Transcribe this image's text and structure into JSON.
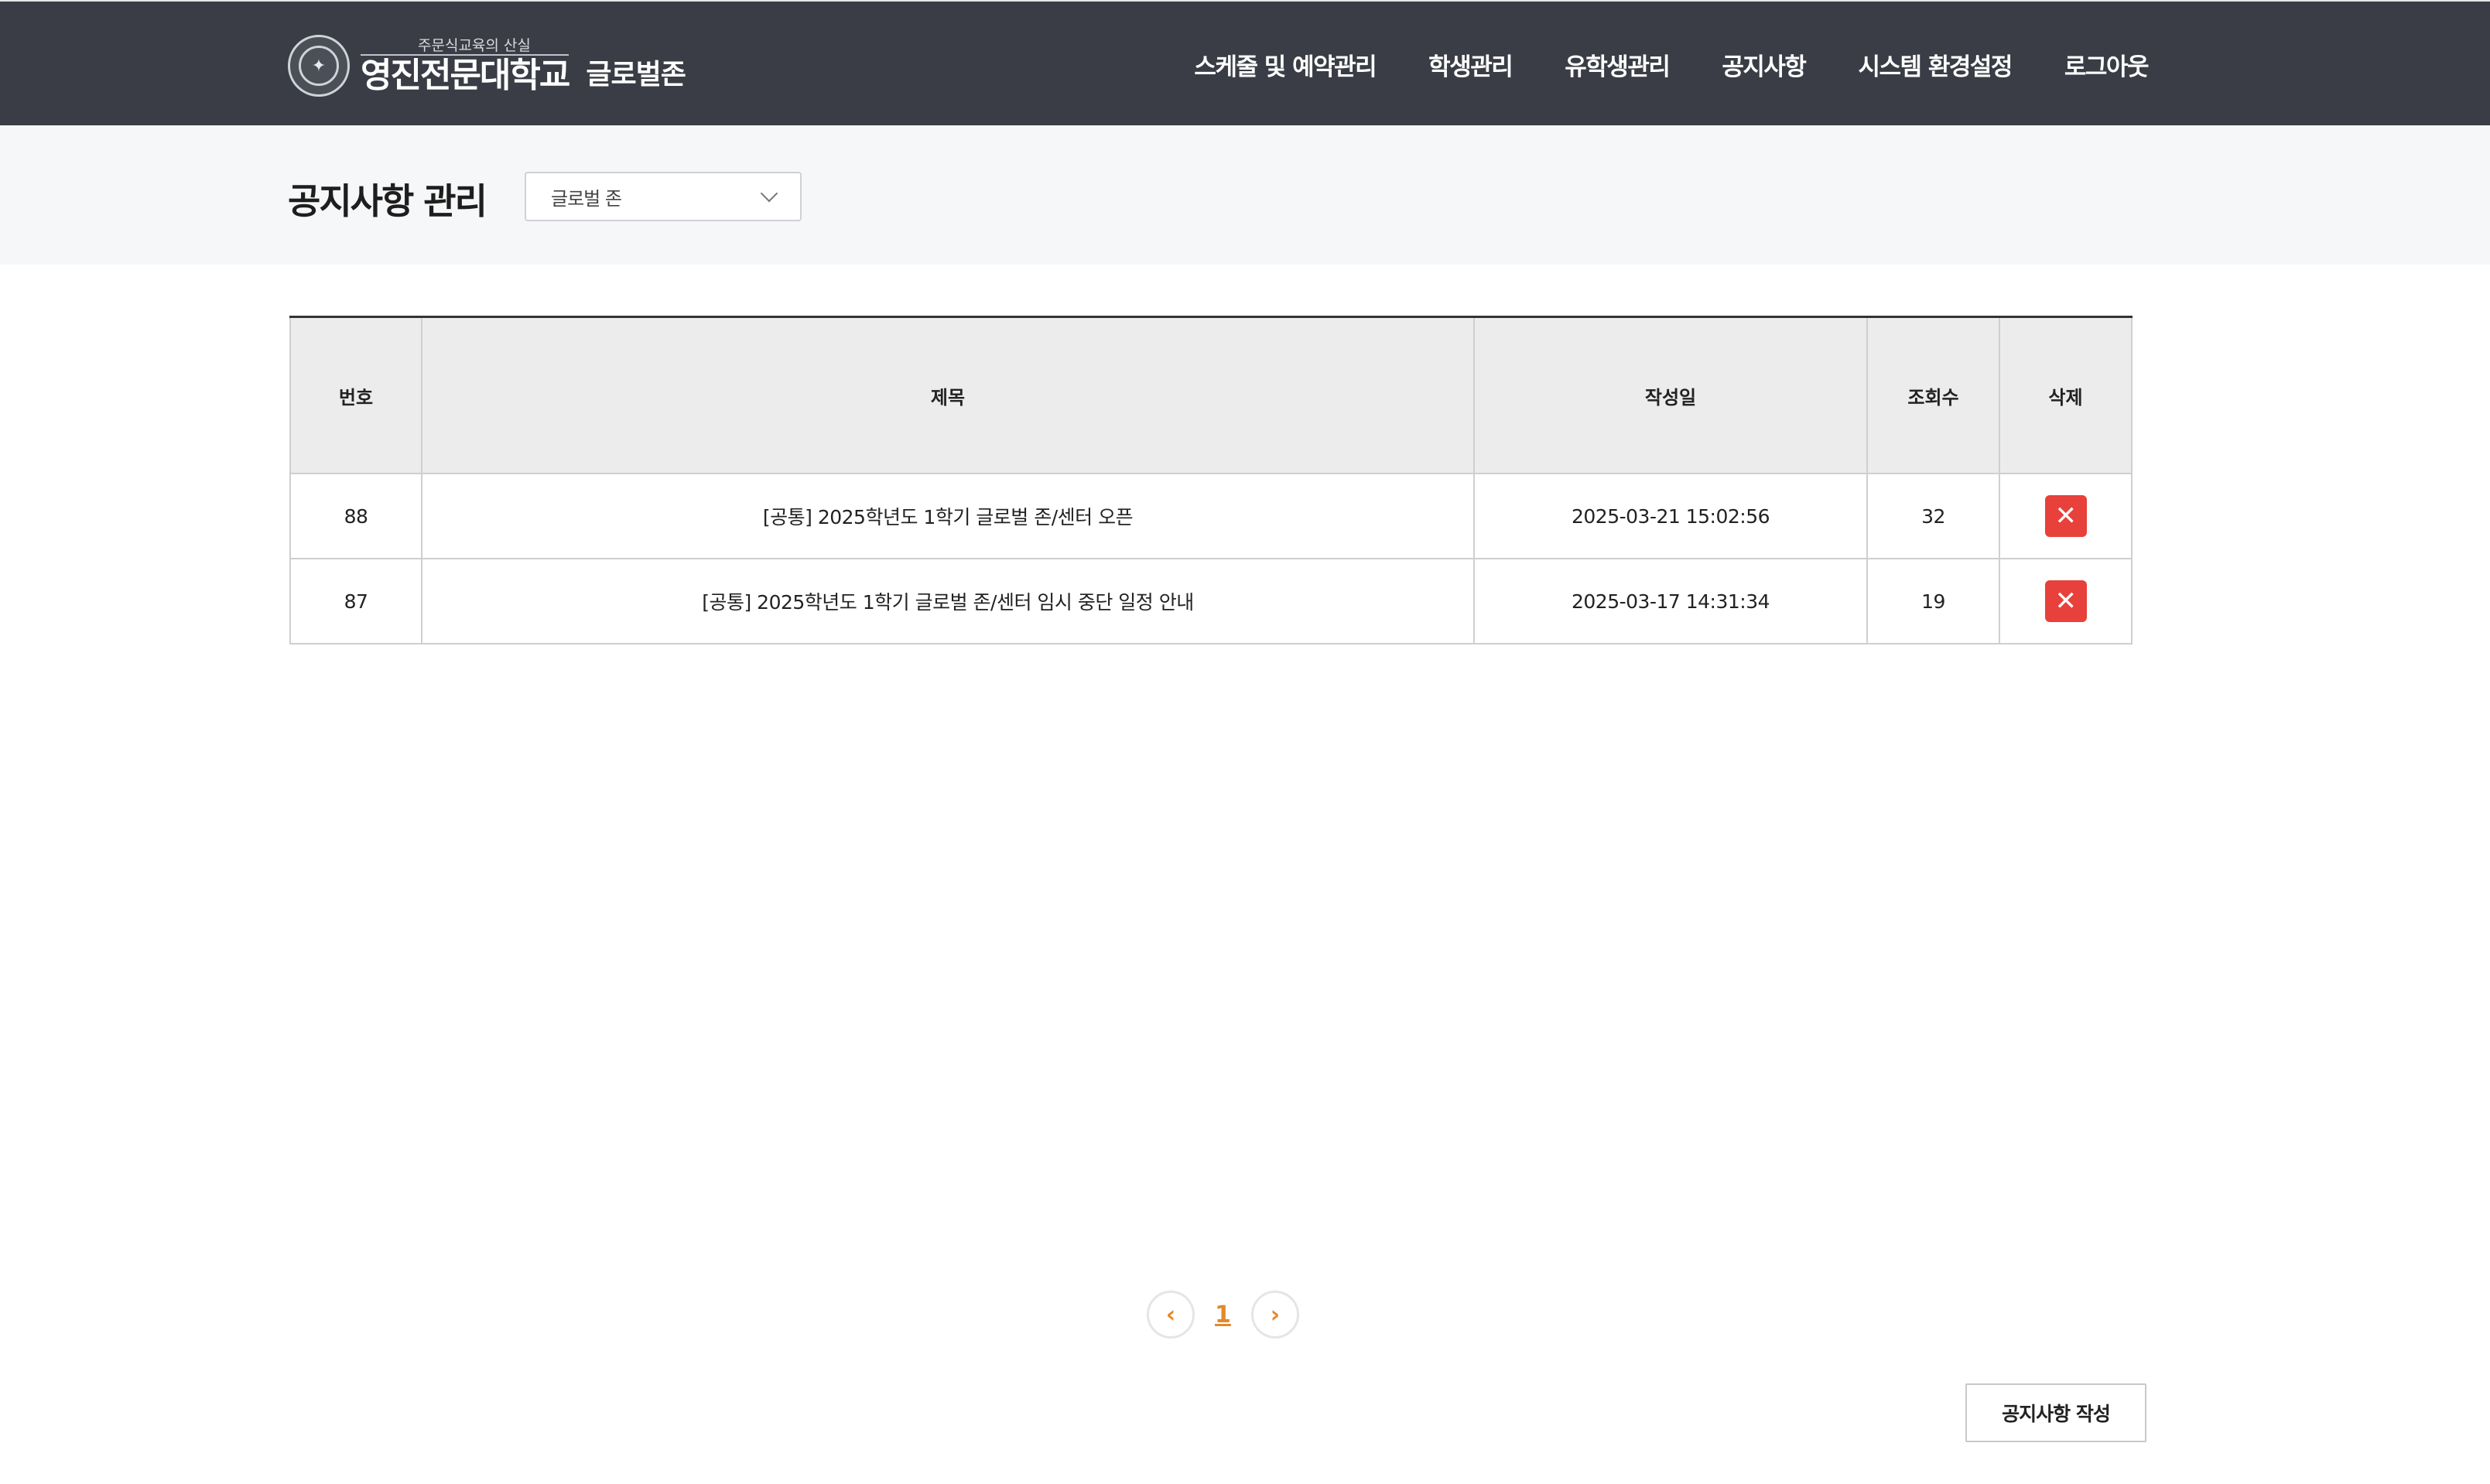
{
  "header": {
    "logo_tag": "주문식교육의 산실",
    "logo_name": "영진전문대학교",
    "logo_sub": "글로벌존",
    "nav": [
      {
        "label": "스케줄 및 예약관리"
      },
      {
        "label": "학생관리"
      },
      {
        "label": "유학생관리"
      },
      {
        "label": "공지사항"
      },
      {
        "label": "시스템 환경설정"
      },
      {
        "label": "로그아웃"
      }
    ]
  },
  "page": {
    "title": "공지사항 관리",
    "zone_select": "글로벌 존"
  },
  "table": {
    "headers": [
      "번호",
      "제목",
      "작성일",
      "조회수",
      "삭제"
    ],
    "rows": [
      {
        "no": "88",
        "title": "[공통] 2025학년도 1학기 글로벌 존/센터 오픈",
        "date": "2025-03-21 15:02:56",
        "views": "32",
        "delete": "✕"
      },
      {
        "no": "87",
        "title": "[공통] 2025학년도 1학기 글로벌 존/센터 임시 중단 일정 안내",
        "date": "2025-03-17 14:31:34",
        "views": "19",
        "delete": "✕"
      }
    ]
  },
  "pagination": {
    "prev": "‹",
    "current": "1",
    "next": "›"
  },
  "actions": {
    "write_label": "공지사항 작성"
  },
  "colors": {
    "header_bg": "#3a3d45",
    "delete_red": "#e8403a",
    "pager_accent": "#e08a2a"
  }
}
